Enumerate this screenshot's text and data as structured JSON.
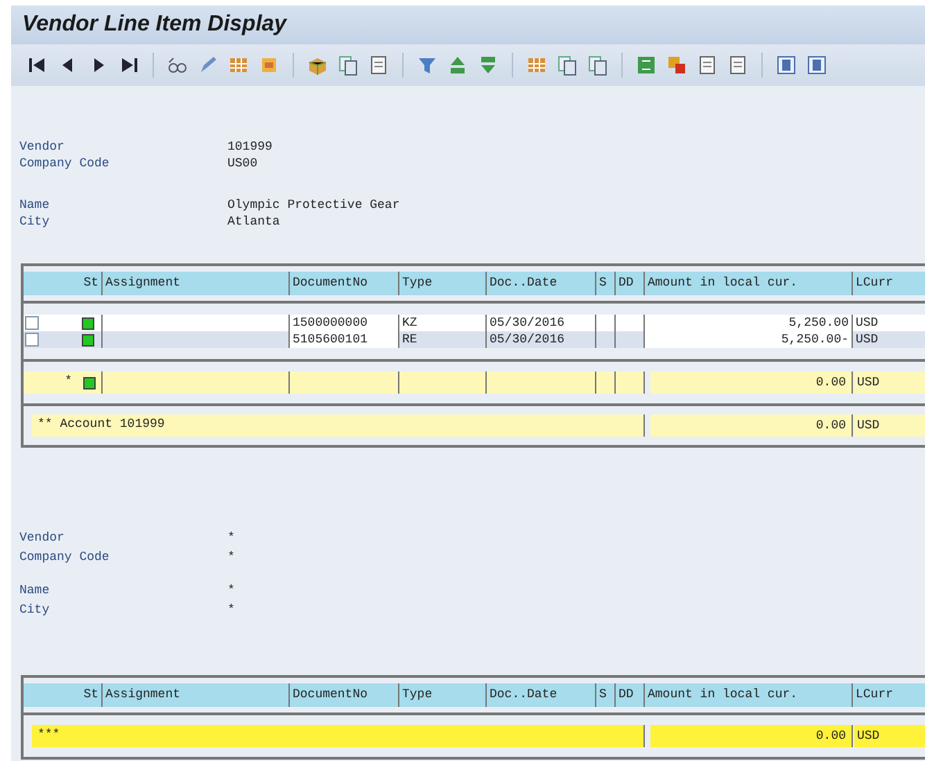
{
  "window": {
    "title": "Vendor Line Item Display"
  },
  "toolbar": {
    "buttons": [
      {
        "kind": "first"
      },
      {
        "kind": "prev"
      },
      {
        "kind": "next"
      },
      {
        "kind": "last"
      },
      {
        "kind": "sep"
      },
      {
        "kind": "glasses"
      },
      {
        "kind": "pencil"
      },
      {
        "kind": "grid"
      },
      {
        "kind": "doc"
      },
      {
        "kind": "sep"
      },
      {
        "kind": "box"
      },
      {
        "kind": "copy"
      },
      {
        "kind": "page"
      },
      {
        "kind": "sep"
      },
      {
        "kind": "filter"
      },
      {
        "kind": "sortup"
      },
      {
        "kind": "sortdown"
      },
      {
        "kind": "sep"
      },
      {
        "kind": "grid"
      },
      {
        "kind": "copy"
      },
      {
        "kind": "copy"
      },
      {
        "kind": "sep"
      },
      {
        "kind": "sum"
      },
      {
        "kind": "subtotal"
      },
      {
        "kind": "page"
      },
      {
        "kind": "page"
      },
      {
        "kind": "sep"
      },
      {
        "kind": "column"
      },
      {
        "kind": "column"
      }
    ]
  },
  "blocks": [
    {
      "fields": [
        [
          {
            "label": "Vendor",
            "value": "101999"
          },
          {
            "label": "Company Code",
            "value": "US00"
          }
        ],
        [
          {
            "label": "Name",
            "value": "Olympic Protective Gear"
          },
          {
            "label": "City",
            "value": "Atlanta"
          }
        ]
      ],
      "table": {
        "columns": [
          "St",
          "Assignment",
          "DocumentNo",
          "Type",
          "Doc..Date",
          "S",
          "DD",
          "Amount in local cur.",
          "LCurr"
        ],
        "rows": [
          {
            "kind": "item",
            "checked": false,
            "cells": [
              "",
              "1500000000",
              "KZ",
              "05/30/2016",
              "",
              "",
              "5,250.00",
              "USD"
            ]
          },
          {
            "kind": "item",
            "checked": false,
            "cells": [
              "",
              "5105600101",
              "RE",
              "05/30/2016",
              "",
              "",
              "5,250.00-",
              "USD"
            ]
          },
          {
            "kind": "subtotal",
            "marker": "*",
            "amount": "0.00",
            "currency": "USD"
          },
          {
            "kind": "total",
            "label": "** Account 101999",
            "amount": "0.00",
            "currency": "USD"
          }
        ]
      }
    },
    {
      "fields": [
        [
          {
            "label": "Vendor",
            "value": "*"
          },
          {
            "label": "Company Code",
            "value": "*"
          }
        ],
        [
          {
            "label": "Name",
            "value": "*"
          },
          {
            "label": "City",
            "value": "*"
          }
        ]
      ],
      "table": {
        "columns": [
          "St",
          "Assignment",
          "DocumentNo",
          "Type",
          "Doc..Date",
          "S",
          "DD",
          "Amount in local cur.",
          "LCurr"
        ],
        "rows": [
          {
            "kind": "grandtotal",
            "label": "***",
            "amount": "0.00",
            "currency": "USD"
          }
        ]
      }
    }
  ]
}
